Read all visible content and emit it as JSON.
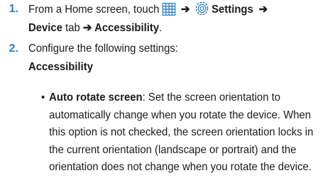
{
  "steps": [
    {
      "number": "1.",
      "line1": {
        "prefix": "From a Home screen, touch",
        "apps_icon": "apps-grid-icon",
        "arrow1": "➔",
        "settings_icon": "settings-gear-icon",
        "settings_label": "Settings",
        "arrow2": "➔"
      },
      "line2": {
        "device_label": "Device",
        "tab_word": " tab ",
        "arrow3": "➔",
        "accessibility_label": "Accessibility",
        "period": "."
      }
    },
    {
      "number": "2.",
      "text": "Configure the following settings:"
    }
  ],
  "section_heading": "Accessibility",
  "bullet": {
    "term": "Auto rotate screen",
    "colon": ":",
    "lines": [
      " Set the screen orientation to",
      "automatically change when you rotate the device. When",
      "this option is not checked, the screen orientation locks in",
      "the current orientation (landscape or portrait) and the",
      "orientation does not change when you rotate the device."
    ]
  },
  "colors": {
    "step_number": "#2f7fc1",
    "icon_blue": "#2f7fc1",
    "text": "#1a1a1a"
  }
}
